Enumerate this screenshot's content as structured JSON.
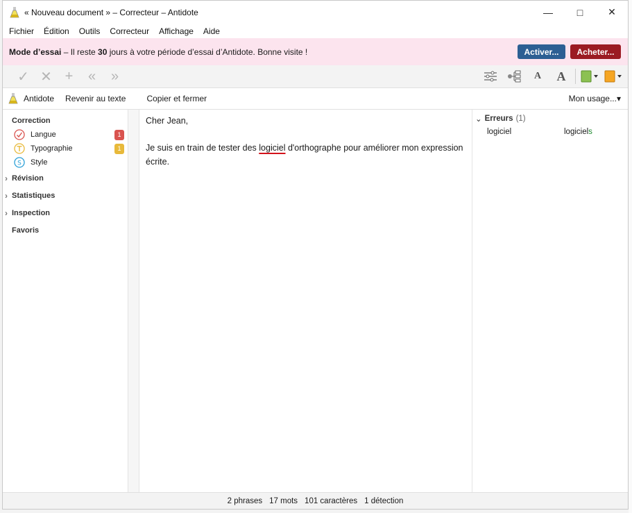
{
  "window": {
    "title": "« Nouveau document » – Correcteur – Antidote"
  },
  "menu": [
    "Fichier",
    "Édition",
    "Outils",
    "Correcteur",
    "Affichage",
    "Aide"
  ],
  "trial": {
    "label": "Mode d’essai",
    "text_before": " – Il reste ",
    "days": "30",
    "text_after": " jours à votre période d’essai d’Antidote. Bonne visite !",
    "activate": "Activer...",
    "buy": "Acheter..."
  },
  "commands": {
    "antidote": "Antidote",
    "back": "Revenir au texte",
    "copy_close": "Copier et fermer",
    "usage": "Mon usage..."
  },
  "sidebar": {
    "correction": "Correction",
    "items": [
      {
        "label": "Langue",
        "count": "1",
        "color": "#d9534f"
      },
      {
        "label": "Typographie",
        "count": "1",
        "color": "#e8b93a"
      },
      {
        "label": "Style",
        "count": "",
        "color": "#2a9fd6"
      }
    ],
    "groups": [
      "Révision",
      "Statistiques",
      "Inspection",
      "Favoris"
    ]
  },
  "document": {
    "greeting": "Cher Jean,",
    "line_before": "Je suis en train de tester des ",
    "error_word": "logiciel",
    "line_after": " d'orthographe pour améliorer mon expression écrite."
  },
  "errors_panel": {
    "title": "Erreurs",
    "count": "(1)",
    "rows": [
      {
        "word": "logiciel",
        "suggestion_base": "logiciel",
        "suggestion_fix": "s"
      }
    ]
  },
  "status": {
    "phrases": "2 phrases",
    "words": "17 mots",
    "chars": "101 caractères",
    "detections": "1 détection"
  }
}
